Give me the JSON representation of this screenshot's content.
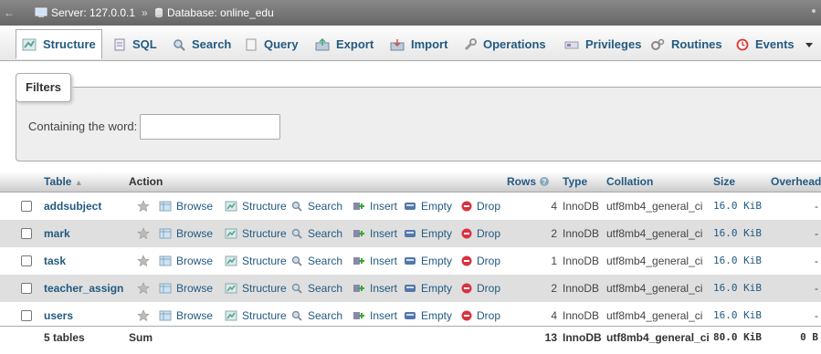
{
  "breadcrumb": {
    "server": "Server: 127.0.0.1",
    "separator": "»",
    "database": "Database: online_edu"
  },
  "tabs": [
    {
      "label": "Structure",
      "icon": "structure-icon",
      "active": true
    },
    {
      "label": "SQL",
      "icon": "sql-icon"
    },
    {
      "label": "Search",
      "icon": "search-icon"
    },
    {
      "label": "Query",
      "icon": "query-icon"
    },
    {
      "label": "Export",
      "icon": "export-icon"
    },
    {
      "label": "Import",
      "icon": "import-icon"
    },
    {
      "label": "Operations",
      "icon": "wrench-icon"
    },
    {
      "label": "Privileges",
      "icon": "privileges-icon"
    },
    {
      "label": "Routines",
      "icon": "routines-icon"
    },
    {
      "label": "Events",
      "icon": "clock-icon"
    }
  ],
  "filters": {
    "legend": "Filters",
    "label": "Containing the word:",
    "value": ""
  },
  "table": {
    "headers": {
      "table": "Table",
      "action": "Action",
      "rows": "Rows",
      "type": "Type",
      "collation": "Collation",
      "size": "Size",
      "overhead": "Overhead"
    },
    "actions": {
      "browse": "Browse",
      "structure": "Structure",
      "search": "Search",
      "insert": "Insert",
      "empty": "Empty",
      "drop": "Drop"
    },
    "rows": [
      {
        "name": "addsubject",
        "rows": "4",
        "type": "InnoDB",
        "collation": "utf8mb4_general_ci",
        "size": "16.0 KiB",
        "overhead": "-"
      },
      {
        "name": "mark",
        "rows": "2",
        "type": "InnoDB",
        "collation": "utf8mb4_general_ci",
        "size": "16.0 KiB",
        "overhead": "-"
      },
      {
        "name": "task",
        "rows": "1",
        "type": "InnoDB",
        "collation": "utf8mb4_general_ci",
        "size": "16.0 KiB",
        "overhead": "-"
      },
      {
        "name": "teacher_assign",
        "rows": "2",
        "type": "InnoDB",
        "collation": "utf8mb4_general_ci",
        "size": "16.0 KiB",
        "overhead": "-"
      },
      {
        "name": "users",
        "rows": "4",
        "type": "InnoDB",
        "collation": "utf8mb4_general_ci",
        "size": "16.0 KiB",
        "overhead": "-"
      }
    ],
    "summary": {
      "tables": "5 tables",
      "sum": "Sum",
      "rows": "13",
      "type": "InnoDB",
      "collation": "utf8mb4_general_ci",
      "size": "80.0 KiB",
      "overhead": "0 B"
    }
  },
  "colors": {
    "link": "#235a81",
    "row_alt": "#dfdfdf",
    "drop": "#d9333f"
  }
}
